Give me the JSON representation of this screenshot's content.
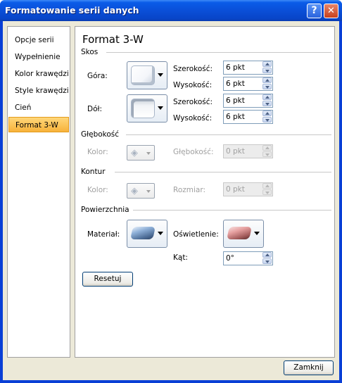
{
  "window": {
    "title": "Formatowanie serii danych",
    "help_glyph": "?",
    "close_glyph": "✕"
  },
  "sidebar": {
    "items": [
      {
        "label": "Opcje serii"
      },
      {
        "label": "Wypełnienie"
      },
      {
        "label": "Kolor krawędzi"
      },
      {
        "label": "Style krawędzi"
      },
      {
        "label": "Cień"
      },
      {
        "label": "Format 3-W",
        "selected": true
      }
    ]
  },
  "panel": {
    "title": "Format 3-W",
    "skos": {
      "label": "Skos",
      "top": {
        "label": "Góra:",
        "width_label": "Szerokość:",
        "width_value": "6 pkt",
        "height_label": "Wysokość:",
        "height_value": "6 pkt"
      },
      "bottom": {
        "label": "Dół:",
        "width_label": "Szerokość:",
        "width_value": "6 pkt",
        "height_label": "Wysokość:",
        "height_value": "6 pkt"
      }
    },
    "glebokosc": {
      "label": "Głębokość",
      "color_label": "Kolor:",
      "depth_label": "Głębokość:",
      "depth_value": "0 pkt"
    },
    "kontur": {
      "label": "Kontur",
      "color_label": "Kolor:",
      "size_label": "Rozmiar:",
      "size_value": "0 pkt"
    },
    "powierzchnia": {
      "label": "Powierzchnia",
      "material_label": "Materiał:",
      "lighting_label": "Oświetlenie:",
      "angle_label": "Kąt:",
      "angle_value": "0°"
    },
    "reset_label": "Resetuj"
  },
  "footer": {
    "close_label": "Zamknij"
  },
  "colors": {
    "title_bar": "#0a4fd8",
    "selected_item": "#f7b23a",
    "dialog_bg": "#ece9d8"
  }
}
